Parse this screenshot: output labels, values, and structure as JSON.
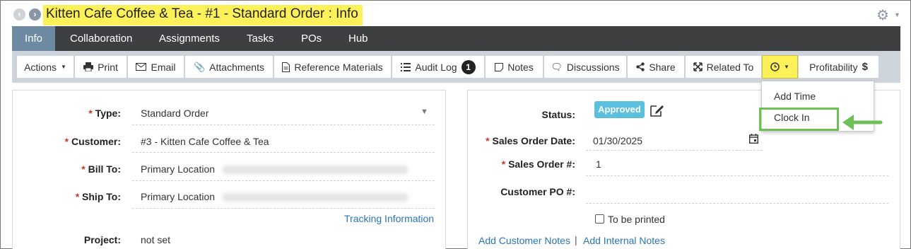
{
  "window": {
    "title": "Kitten Cafe Coffee & Tea - #1 - Standard Order : Info"
  },
  "tabs": [
    {
      "label": "Info",
      "active": true
    },
    {
      "label": "Collaboration"
    },
    {
      "label": "Assignments"
    },
    {
      "label": "Tasks"
    },
    {
      "label": "POs"
    },
    {
      "label": "Hub"
    }
  ],
  "toolbar": {
    "actions": "Actions",
    "print": "Print",
    "email": "Email",
    "attachments": "Attachments",
    "reference_materials": "Reference Materials",
    "audit_log": "Audit Log",
    "audit_log_count": "1",
    "notes": "Notes",
    "discussions": "Discussions",
    "share": "Share",
    "related_to": "Related To",
    "profitability": "Profitability"
  },
  "time_menu": {
    "items": [
      "Add Time",
      "Clock In"
    ]
  },
  "left_form": {
    "type_label": "Type:",
    "type_value": "Standard Order",
    "customer_label": "Customer:",
    "customer_value": "#3 - Kitten Cafe Coffee & Tea",
    "bill_to_label": "Bill To:",
    "bill_to_value": "Primary Location",
    "ship_to_label": "Ship To:",
    "ship_to_value": "Primary Location",
    "tracking_link": "Tracking Information",
    "project_label": "Project:",
    "project_value": "not set",
    "required_mark": "*"
  },
  "right_form": {
    "status_label": "Status:",
    "status_value": "Approved",
    "sales_order_date_label": "Sales Order Date:",
    "sales_order_date_value": "01/30/2025",
    "sales_order_num_label": "Sales Order #:",
    "sales_order_num_value": "1",
    "customer_po_label": "Customer PO #:",
    "customer_po_value": "",
    "to_be_printed_label": "To be printed",
    "to_be_printed_checked": false,
    "add_customer_notes": "Add Customer Notes",
    "separator": "|",
    "add_internal_notes": "Add Internal Notes"
  },
  "colors": {
    "title_highlight": "#fdf15a",
    "tab_bar": "#3e3f40",
    "tab_active": "#6e8aa3",
    "status_badge": "#5bc0de",
    "callout_green": "#6fbf58",
    "link": "#2a74b8"
  }
}
